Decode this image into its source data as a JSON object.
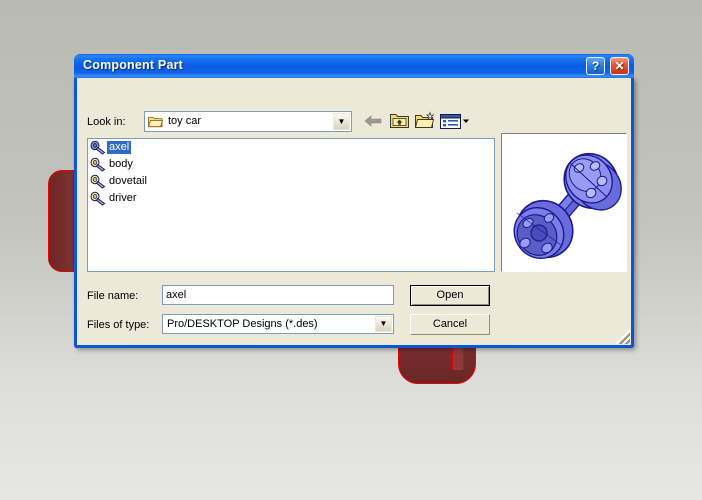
{
  "window": {
    "title": "Component Part",
    "help_button": "?",
    "close_button": "✕"
  },
  "toolbar": {
    "lookin_label": "Look in:",
    "lookin_value": "toy car",
    "dropdown_arrow": "▼",
    "buttons": [
      {
        "name": "back-button",
        "tooltip": "Back"
      },
      {
        "name": "up-one-level-button",
        "tooltip": "Up One Level"
      },
      {
        "name": "create-new-folder-button",
        "tooltip": "Create New Folder"
      },
      {
        "name": "views-button",
        "tooltip": "Views"
      }
    ]
  },
  "file_list": {
    "items": [
      {
        "label": "axel",
        "selected": true,
        "icon": "part-icon"
      },
      {
        "label": "body",
        "selected": false,
        "icon": "part-icon"
      },
      {
        "label": "dovetail",
        "selected": false,
        "icon": "part-icon"
      },
      {
        "label": "driver",
        "selected": false,
        "icon": "part-icon"
      }
    ]
  },
  "preview": {
    "description": "3D CAD render of axle part",
    "colors": {
      "body": "#7b7de8",
      "edge": "#1a1a8c",
      "highlight": "#a6a8f5",
      "shadow": "#4a4ab8"
    }
  },
  "form": {
    "filename_label": "File name:",
    "filename_value": "axel",
    "filetype_label": "Files of type:",
    "filetype_value": "Pro/DESKTOP Designs (*.des)",
    "open_label": "Open",
    "cancel_label": "Cancel"
  },
  "colors": {
    "titlebar_blue": "#0a5ce4",
    "dialog_face": "#ece9d8",
    "selection_blue": "#316ac5",
    "cad_red": "#7b2c2c",
    "cad_red_edge": "#ee0000"
  }
}
